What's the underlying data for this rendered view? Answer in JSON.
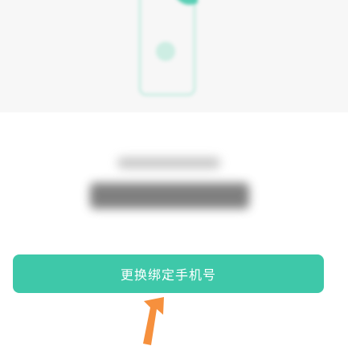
{
  "rebind_button": {
    "label": "更换绑定手机号"
  },
  "icons": {
    "phone": "phone-illustration-icon",
    "pointer": "arrow-up-pointer-icon"
  },
  "colors": {
    "button_background": "#3ec8a9",
    "illustration_stroke": "#c7ece2",
    "illustration_fill": "#bfe9dc",
    "arrow": "#f6903d",
    "top_background": "#f7f7f7"
  }
}
